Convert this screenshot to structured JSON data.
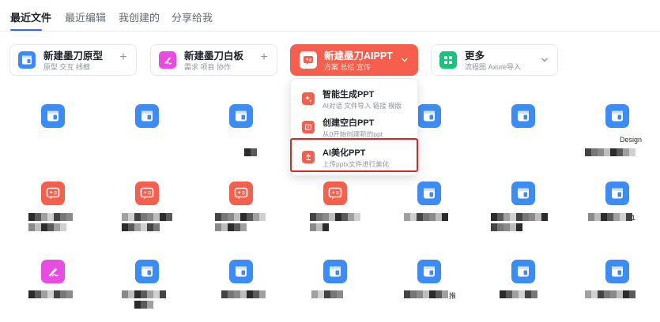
{
  "tabs": [
    {
      "label": "最近文件",
      "active": true
    },
    {
      "label": "最近编辑",
      "active": false
    },
    {
      "label": "我创建的",
      "active": false
    },
    {
      "label": "分享给我",
      "active": false
    }
  ],
  "cards": [
    {
      "title": "新建墨刀原型",
      "subtitle": "原型 交互 线框",
      "icon": "prototype-icon",
      "action": "plus"
    },
    {
      "title": "新建墨刀白板",
      "subtitle": "需求 项目 协作",
      "icon": "whiteboard-icon",
      "action": "plus"
    },
    {
      "title": "新建墨刀AIPPT",
      "subtitle": "方案 总结 宣传",
      "icon": "aippt-icon",
      "action": "chevron"
    },
    {
      "title": "更多",
      "subtitle": "流程图 Axure导入",
      "icon": "grid-apps-icon",
      "action": "chevron"
    }
  ],
  "dropdown": {
    "items": [
      {
        "title": "智能生成PPT",
        "subtitle": "AI对话 文件导入 链接 模版",
        "icon": "sparkle-icon"
      },
      {
        "title": "创建空白PPT",
        "subtitle": "从0开始创建新的ppt",
        "icon": "blank-ppt-icon"
      },
      {
        "title": "AI美化PPT",
        "subtitle": "上传pptx文件进行美化",
        "icon": "upload-icon",
        "highlighted": true
      }
    ]
  },
  "grid_texts": {
    "r1c7": "Design",
    "r2c7": "1",
    "r3c5": "推"
  },
  "colors": {
    "accent": "#2f6bff",
    "ai_red": "#f65f4d",
    "file_blue": "#3d8cf5",
    "whiteboard_pink": "#e94ce0",
    "more_green": "#19c37d",
    "highlight_red": "#e02323"
  }
}
